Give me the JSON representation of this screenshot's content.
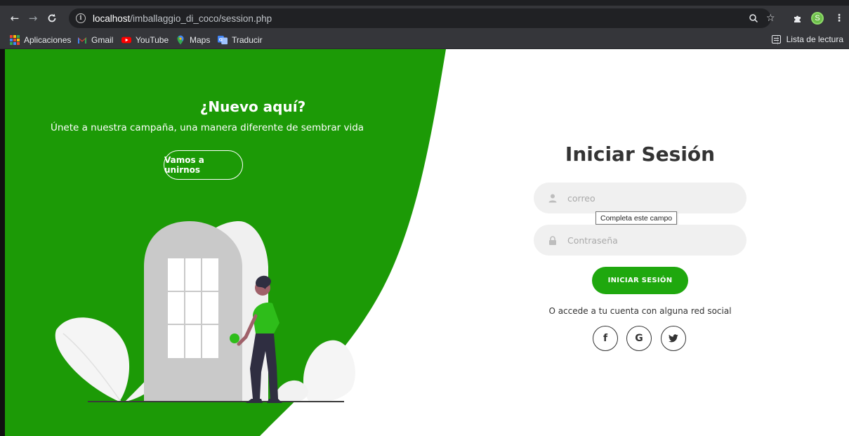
{
  "browser": {
    "url_host": "localhost",
    "url_path": "/imballaggio_di_coco/session.php",
    "profile_initial": "S",
    "bookmarks": [
      {
        "label": "Aplicaciones",
        "icon": "apps-grid-icon"
      },
      {
        "label": "Gmail",
        "icon": "gmail-icon"
      },
      {
        "label": "YouTube",
        "icon": "youtube-icon"
      },
      {
        "label": "Maps",
        "icon": "maps-icon"
      },
      {
        "label": "Traducir",
        "icon": "translate-icon"
      }
    ],
    "reading_list_label": "Lista de lectura"
  },
  "left_panel": {
    "title": "¿Nuevo aquí?",
    "subtitle": "Únete a nuestra campaña, una manera diferente de sembrar vida",
    "button_label": "Vamos a unirnos"
  },
  "login": {
    "title": "Iniciar Sesión",
    "email_placeholder": "correo",
    "password_placeholder": "Contraseña",
    "validation_tooltip": "Completa este campo",
    "submit_label": "INICIAR SESIÓN",
    "social_text": "O accede a tu cuenta con alguna red social",
    "social": [
      {
        "label": "f",
        "icon": "facebook-icon"
      },
      {
        "label": "G",
        "icon": "google-icon"
      },
      {
        "label": "",
        "icon": "twitter-icon"
      }
    ]
  },
  "colors": {
    "brand_green": "#1fa80e",
    "panel_green": "#1c9a06",
    "input_bg": "#f0f0f0",
    "title_text": "#333333"
  }
}
